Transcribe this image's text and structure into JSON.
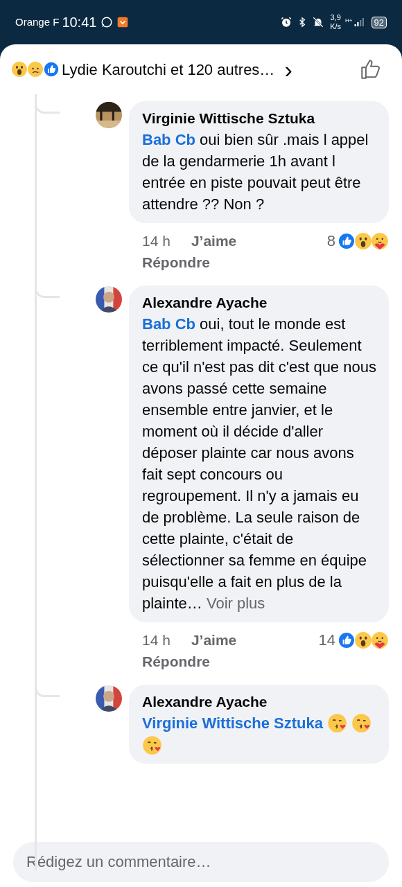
{
  "status_bar": {
    "carrier": "Orange F",
    "time": "10:41",
    "speed_value": "3,9",
    "speed_unit": "K/s",
    "network": "H+",
    "battery": "92"
  },
  "header": {
    "reactions": [
      {
        "kind": "wow"
      },
      {
        "kind": "sad"
      },
      {
        "kind": "like"
      }
    ],
    "summary": "Lydie Karoutchi et 120 autres…",
    "chevron": "›"
  },
  "comments": [
    {
      "author": "Virginie Wittische Sztuka",
      "mention": "Bab Cb",
      "text": " oui bien sûr .mais l appel de la gendarmerie 1h avant l entrée en piste pouvait peut être attendre ?? Non ?",
      "time": "14 h",
      "like": "J’aime",
      "reply": "Répondre",
      "count": "8",
      "reactions": [
        {
          "kind": "like"
        },
        {
          "kind": "wow"
        },
        {
          "kind": "care"
        }
      ]
    },
    {
      "author": "Alexandre Ayache",
      "mention": "Bab Cb",
      "text": " oui, tout le monde est terriblement impacté. Seulement ce qu'il n'est pas dit c'est que nous avons passé cette semaine ensemble entre janvier, et le moment où il décide d'aller déposer plainte car nous avons fait sept concours ou regroupement. Il n'y a jamais eu de problème. La seule raison de cette plainte, c'était de sélectionner sa femme en équipe puisqu'elle a fait en plus de la plainte…",
      "more": "Voir plus",
      "time": "14 h",
      "like": "J’aime",
      "reply": "Répondre",
      "count": "14",
      "reactions": [
        {
          "kind": "like"
        },
        {
          "kind": "wow"
        },
        {
          "kind": "care"
        }
      ]
    },
    {
      "author": "Alexandre Ayache",
      "mention": "Virginie Wittische Sztuka",
      "emojis": [
        {
          "kind": "kiss"
        },
        {
          "kind": "kiss"
        },
        {
          "kind": "kiss"
        }
      ]
    }
  ],
  "composer": {
    "placeholder": "Rédigez un commentaire…"
  }
}
